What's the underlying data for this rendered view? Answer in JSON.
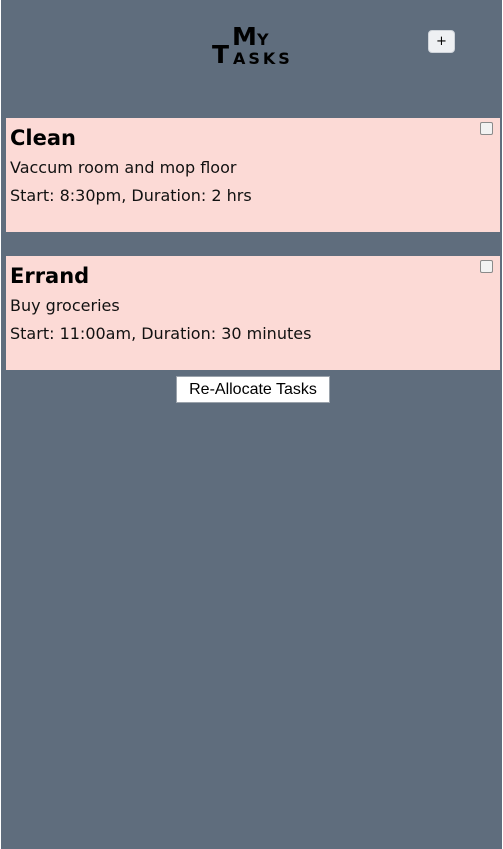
{
  "header": {
    "logo": {
      "my_first": "M",
      "my_rest": "Y",
      "tasks_first": "T",
      "tasks_rest": "ASKS"
    },
    "add_label": "+"
  },
  "tasks": [
    {
      "title": "Clean",
      "description": "Vaccum room and mop floor",
      "schedule": "Start: 8:30pm, Duration: 2 hrs",
      "checked": false
    },
    {
      "title": "Errand",
      "description": "Buy groceries",
      "schedule": "Start: 11:00am, Duration: 30 minutes",
      "checked": false
    }
  ],
  "actions": {
    "reallocate_label": "Re-Allocate Tasks"
  },
  "colors": {
    "background": "#5f6d7d",
    "card": "#fcdad6"
  }
}
